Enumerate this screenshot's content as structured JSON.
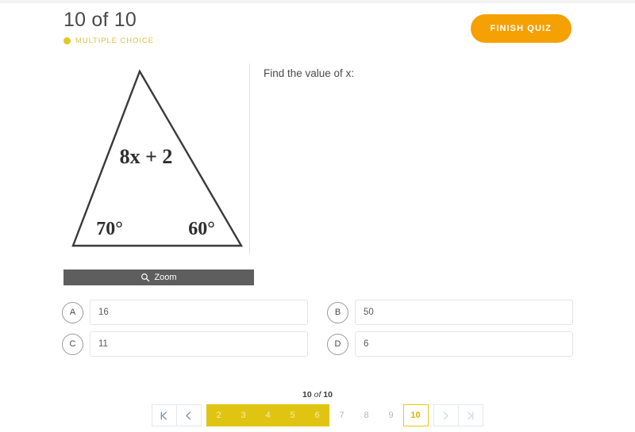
{
  "header": {
    "title": "10 of 10",
    "question_type": "MULTIPLE CHOICE",
    "finish_label": "FINISH QUIZ",
    "accent_orange": "#f5a003",
    "accent_gold": "#dfc512"
  },
  "question": {
    "prompt": "Find the value of x:",
    "zoom_label": "Zoom",
    "figure": {
      "type": "triangle",
      "expression": "8x + 2",
      "angle_left": "70°",
      "angle_right": "60°"
    }
  },
  "answers": [
    {
      "letter": "A",
      "value": "16"
    },
    {
      "letter": "B",
      "value": "50"
    },
    {
      "letter": "C",
      "value": "11"
    },
    {
      "letter": "D",
      "value": "6"
    }
  ],
  "pagination": {
    "counter_current": "10",
    "counter_of": "of",
    "counter_total": "10",
    "pages": [
      {
        "label": "2",
        "state": "filled"
      },
      {
        "label": "3",
        "state": "filled"
      },
      {
        "label": "4",
        "state": "filled"
      },
      {
        "label": "5",
        "state": "filled"
      },
      {
        "label": "6",
        "state": "filled"
      },
      {
        "label": "7",
        "state": "plain"
      },
      {
        "label": "8",
        "state": "plain"
      },
      {
        "label": "9",
        "state": "plain"
      },
      {
        "label": "10",
        "state": "current"
      }
    ],
    "first_icon": "first-page-icon",
    "prev_icon": "previous-page-icon",
    "next_icon": "next-page-icon",
    "last_icon": "last-page-icon"
  }
}
